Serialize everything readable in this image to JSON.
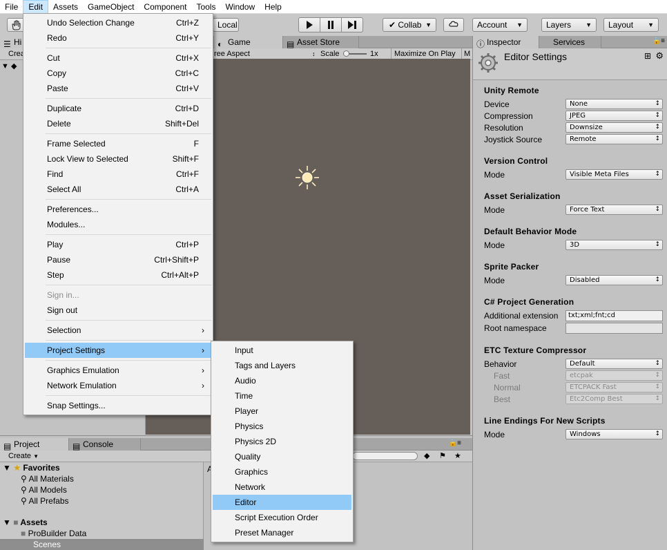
{
  "menubar": {
    "items": [
      {
        "label": "File"
      },
      {
        "label": "Edit",
        "active": true
      },
      {
        "label": "Assets"
      },
      {
        "label": "GameObject"
      },
      {
        "label": "Component"
      },
      {
        "label": "Tools"
      },
      {
        "label": "Window"
      },
      {
        "label": "Help"
      }
    ]
  },
  "toolbar": {
    "local_label": "Local",
    "collab_label": "Collab",
    "account_label": "Account",
    "layers_label": "Layers",
    "layout_label": "Layout"
  },
  "hierarchy": {
    "tab_label": "Hi",
    "create_label": "Crea"
  },
  "game": {
    "tabs": [
      {
        "label": "Game"
      },
      {
        "label": "Asset Store"
      }
    ],
    "aspect_label": "ree Aspect",
    "scale_label": "Scale",
    "scale_value": "1x",
    "maximize_label": "Maximize On Play",
    "m_label": "M"
  },
  "inspector": {
    "tabs": [
      {
        "label": "Inspector"
      },
      {
        "label": "Services"
      }
    ],
    "title": "Editor Settings",
    "sections": {
      "unity_remote": "Unity Remote",
      "version_control": "Version Control",
      "asset_serialization": "Asset Serialization",
      "default_behavior": "Default Behavior Mode",
      "sprite_packer": "Sprite Packer",
      "csharp_gen": "C# Project Generation",
      "etc": "ETC Texture Compressor",
      "line_endings": "Line Endings For New Scripts"
    },
    "fields": {
      "device": {
        "label": "Device",
        "value": "None"
      },
      "compression": {
        "label": "Compression",
        "value": "JPEG"
      },
      "resolution": {
        "label": "Resolution",
        "value": "Downsize"
      },
      "joystick": {
        "label": "Joystick Source",
        "value": "Remote"
      },
      "vc_mode": {
        "label": "Mode",
        "value": "Visible Meta Files"
      },
      "as_mode": {
        "label": "Mode",
        "value": "Force Text"
      },
      "db_mode": {
        "label": "Mode",
        "value": "3D"
      },
      "sp_mode": {
        "label": "Mode",
        "value": "Disabled"
      },
      "add_ext": {
        "label": "Additional extension",
        "value": "txt;xml;fnt;cd"
      },
      "root_ns": {
        "label": "Root namespace",
        "value": ""
      },
      "behavior": {
        "label": "Behavior",
        "value": "Default"
      },
      "fast": {
        "label": "Fast",
        "value": "etcpak"
      },
      "normal": {
        "label": "Normal",
        "value": "ETCPACK Fast"
      },
      "best": {
        "label": "Best",
        "value": "Etc2Comp Best"
      },
      "le_mode": {
        "label": "Mode",
        "value": "Windows"
      }
    }
  },
  "project": {
    "tabs": [
      {
        "label": "Project"
      },
      {
        "label": "Console"
      }
    ],
    "create_label": "Create",
    "tree": {
      "favorites": "Favorites",
      "all_materials": "All Materials",
      "all_models": "All Models",
      "all_prefabs": "All Prefabs",
      "assets": "Assets",
      "probuilder": "ProBuilder Data",
      "scenes": "Scenes"
    },
    "col_a": "A"
  },
  "edit_menu": {
    "items": [
      {
        "label": "Undo Selection Change",
        "shortcut": "Ctrl+Z"
      },
      {
        "label": "Redo",
        "shortcut": "Ctrl+Y"
      },
      {
        "label": "Cut",
        "shortcut": "Ctrl+X"
      },
      {
        "label": "Copy",
        "shortcut": "Ctrl+C"
      },
      {
        "label": "Paste",
        "shortcut": "Ctrl+V"
      },
      {
        "label": "Duplicate",
        "shortcut": "Ctrl+D"
      },
      {
        "label": "Delete",
        "shortcut": "Shift+Del"
      },
      {
        "label": "Frame Selected",
        "shortcut": "F"
      },
      {
        "label": "Lock View to Selected",
        "shortcut": "Shift+F"
      },
      {
        "label": "Find",
        "shortcut": "Ctrl+F"
      },
      {
        "label": "Select All",
        "shortcut": "Ctrl+A"
      },
      {
        "label": "Preferences...",
        "shortcut": ""
      },
      {
        "label": "Modules...",
        "shortcut": ""
      },
      {
        "label": "Play",
        "shortcut": "Ctrl+P"
      },
      {
        "label": "Pause",
        "shortcut": "Ctrl+Shift+P"
      },
      {
        "label": "Step",
        "shortcut": "Ctrl+Alt+P"
      },
      {
        "label": "Sign in...",
        "shortcut": ""
      },
      {
        "label": "Sign out",
        "shortcut": ""
      },
      {
        "label": "Selection",
        "shortcut": ""
      },
      {
        "label": "Project Settings",
        "shortcut": ""
      },
      {
        "label": "Graphics Emulation",
        "shortcut": ""
      },
      {
        "label": "Network Emulation",
        "shortcut": ""
      },
      {
        "label": "Snap Settings...",
        "shortcut": ""
      }
    ]
  },
  "project_settings_menu": {
    "items": [
      {
        "label": "Input"
      },
      {
        "label": "Tags and Layers"
      },
      {
        "label": "Audio"
      },
      {
        "label": "Time"
      },
      {
        "label": "Player"
      },
      {
        "label": "Physics"
      },
      {
        "label": "Physics 2D"
      },
      {
        "label": "Quality"
      },
      {
        "label": "Graphics"
      },
      {
        "label": "Network"
      },
      {
        "label": "Editor"
      },
      {
        "label": "Script Execution Order"
      },
      {
        "label": "Preset Manager"
      }
    ]
  }
}
